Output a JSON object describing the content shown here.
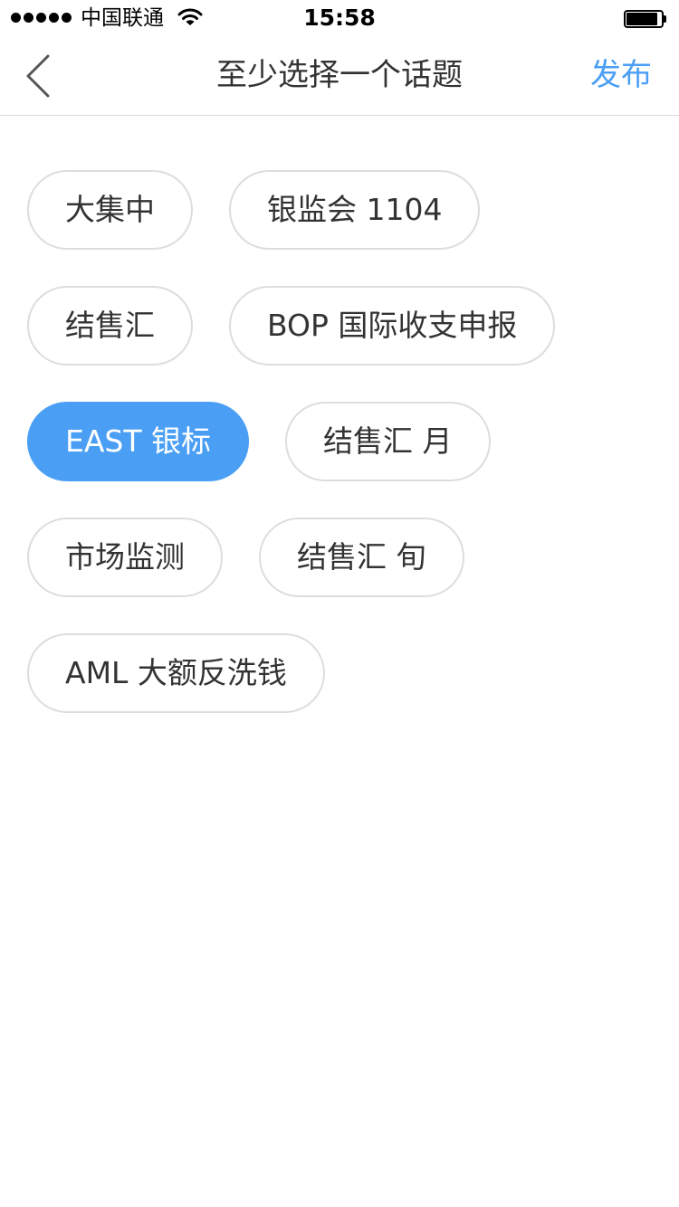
{
  "status_bar": {
    "carrier": "中国联通",
    "time": "15:58",
    "signal_icon": "signal-dots-icon",
    "wifi_icon": "wifi-icon",
    "battery_icon": "battery-icon"
  },
  "nav": {
    "back_icon": "chevron-left-icon",
    "title": "至少选择一个话题",
    "publish_label": "发布"
  },
  "colors": {
    "accent": "#4a9ff5",
    "chip_border": "#dddddd",
    "text": "#333333"
  },
  "topics": [
    {
      "label": "大集中",
      "selected": false
    },
    {
      "label": "银监会 1104",
      "selected": false
    },
    {
      "label": "结售汇",
      "selected": false
    },
    {
      "label": "BOP 国际收支申报",
      "selected": false
    },
    {
      "label": "EAST 银标",
      "selected": true
    },
    {
      "label": "结售汇 月",
      "selected": false
    },
    {
      "label": "市场监测",
      "selected": false
    },
    {
      "label": "结售汇 旬",
      "selected": false
    },
    {
      "label": "AML 大额反洗钱",
      "selected": false
    }
  ]
}
